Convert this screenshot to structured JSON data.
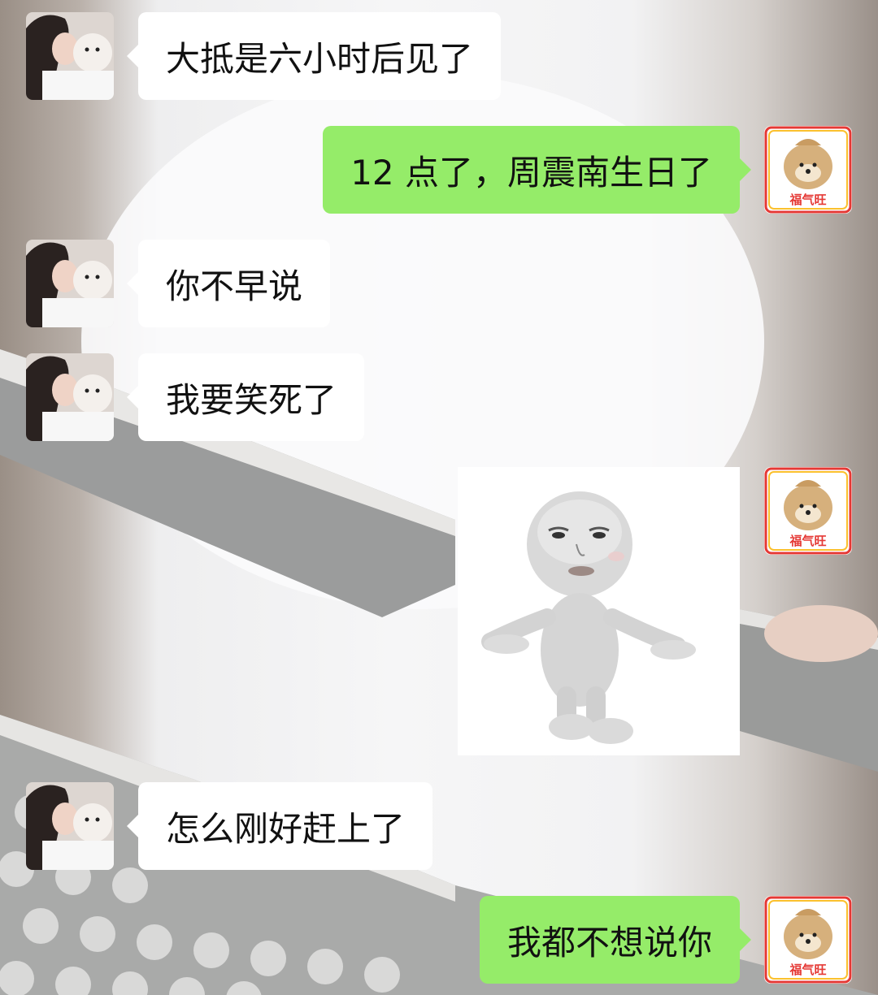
{
  "messages": [
    {
      "side": "in",
      "text": "大抵是六小时后见了"
    },
    {
      "side": "out",
      "text": "12 点了，周震南生日了"
    },
    {
      "side": "in",
      "text": "你不早说"
    },
    {
      "side": "in",
      "text": "我要笑死了"
    },
    {
      "side": "out",
      "type": "sticker",
      "sticker_icon": "shrugging-figure-sticker"
    },
    {
      "side": "in",
      "text": "怎么刚好赶上了"
    },
    {
      "side": "out",
      "text": "我都不想说你"
    }
  ],
  "self_avatar": {
    "label": "福气旺",
    "icon": "lucky-dog-bag-avatar"
  },
  "contact_avatar": {
    "icon": "girl-with-white-dog-avatar"
  },
  "colors": {
    "outgoing_bubble": "#95ec69",
    "incoming_bubble": "#ffffff"
  }
}
